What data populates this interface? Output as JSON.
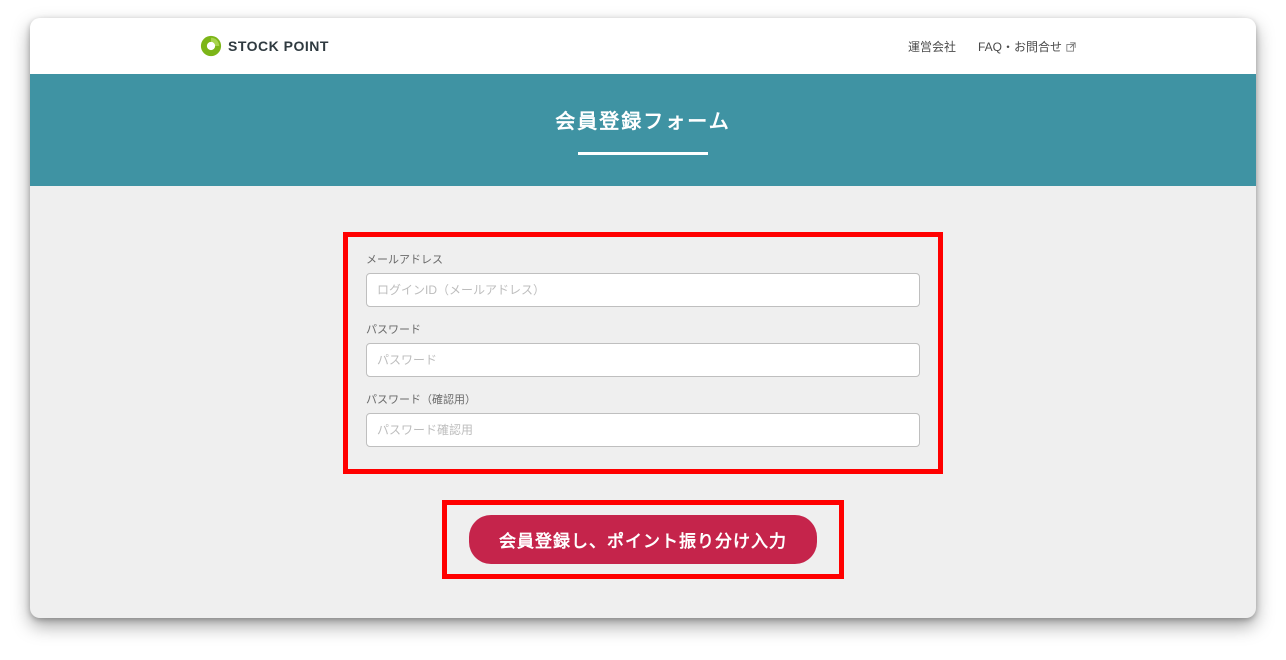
{
  "header": {
    "logo_text": "STOCK POINT",
    "nav": {
      "company": "運営会社",
      "faq": "FAQ・お問合せ"
    }
  },
  "banner": {
    "title": "会員登録フォーム"
  },
  "form": {
    "email": {
      "label": "メールアドレス",
      "placeholder": "ログインID（メールアドレス）"
    },
    "password": {
      "label": "パスワード",
      "placeholder": "パスワード"
    },
    "password_confirm": {
      "label": "パスワード（確認用）",
      "placeholder": "パスワード確認用"
    },
    "submit_label": "会員登録し、ポイント振り分け入力"
  }
}
